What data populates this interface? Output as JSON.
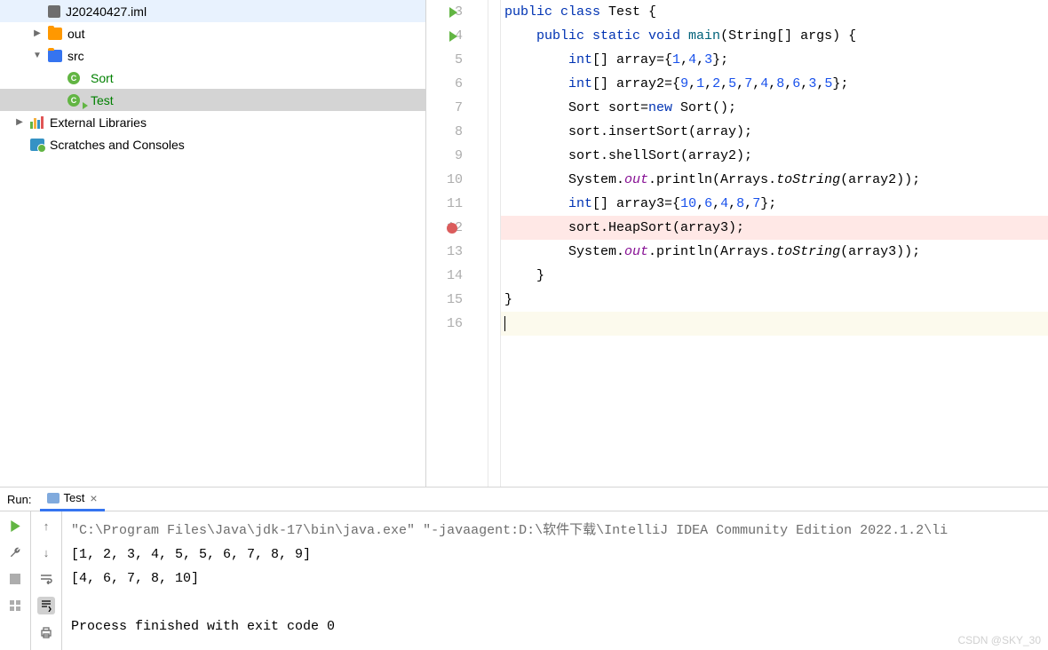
{
  "sidebar": {
    "iml": "J20240427.iml",
    "out": "out",
    "src": "src",
    "sort": "Sort",
    "test": "Test",
    "ext": "External Libraries",
    "scratch": "Scratches and Consoles"
  },
  "gutter": [
    "3",
    "4",
    "5",
    "6",
    "7",
    "8",
    "9",
    "10",
    "11",
    "12",
    "13",
    "14",
    "15",
    "16"
  ],
  "code": {
    "l3": {
      "a": "public",
      "b": " class",
      " c": " Test {"
    },
    "l4": {
      "a": "    public",
      "b": " static",
      "c": " void",
      "d": " main",
      "e": "(String[] args) {"
    },
    "l5": {
      "a": "        int",
      "b": "[] array={",
      "n1": "1",
      "c": ",",
      "n2": "4",
      "d": ",",
      "n3": "3",
      "e": "};"
    },
    "l6": {
      "a": "        int",
      "b": "[] array2={",
      "n1": "9",
      "c1": ",",
      "n2": "1",
      "c2": ",",
      "n3": "2",
      "c3": ",",
      "n4": "5",
      "c4": ",",
      "n5": "7",
      "c5": ",",
      "n6": "4",
      "c6": ",",
      "n7": "8",
      "c7": ",",
      "n8": "6",
      "c8": ",",
      "n9": "3",
      "c9": ",",
      "n10": "5",
      "e": "};"
    },
    "l7": {
      "a": "        Sort sort=",
      "b": "new",
      "c": " Sort();"
    },
    "l8": "        sort.insertSort(array);",
    "l9": "        sort.shellSort(array2);",
    "l10": {
      "a": "        System.",
      "b": "out",
      "c": ".println(Arrays.",
      "d": "toString",
      "e": "(array2));"
    },
    "l11": {
      "a": "        int",
      "b": "[] array3={",
      "n1": "10",
      "c1": ",",
      "n2": "6",
      "c2": ",",
      "n3": "4",
      "c3": ",",
      "n4": "8",
      "c4": ",",
      "n5": "7",
      "e": "};"
    },
    "l12": "        sort.HeapSort(array3);",
    "l13": {
      "a": "        System.",
      "b": "out",
      "c": ".println(Arrays.",
      "d": "toString",
      "e": "(array3));"
    },
    "l14": "    }",
    "l15": "}",
    "l16": ""
  },
  "run": {
    "label": "Run:",
    "tab": "Test",
    "cmd": "\"C:\\Program Files\\Java\\jdk-17\\bin\\java.exe\" \"-javaagent:D:\\软件下载\\IntelliJ IDEA Community Edition 2022.1.2\\li",
    "out1": "[1, 2, 3, 4, 5, 5, 6, 7, 8, 9]",
    "out2": "[4, 6, 7, 8, 10]",
    "exit": "Process finished with exit code 0"
  },
  "watermark": "CSDN @SKY_30"
}
